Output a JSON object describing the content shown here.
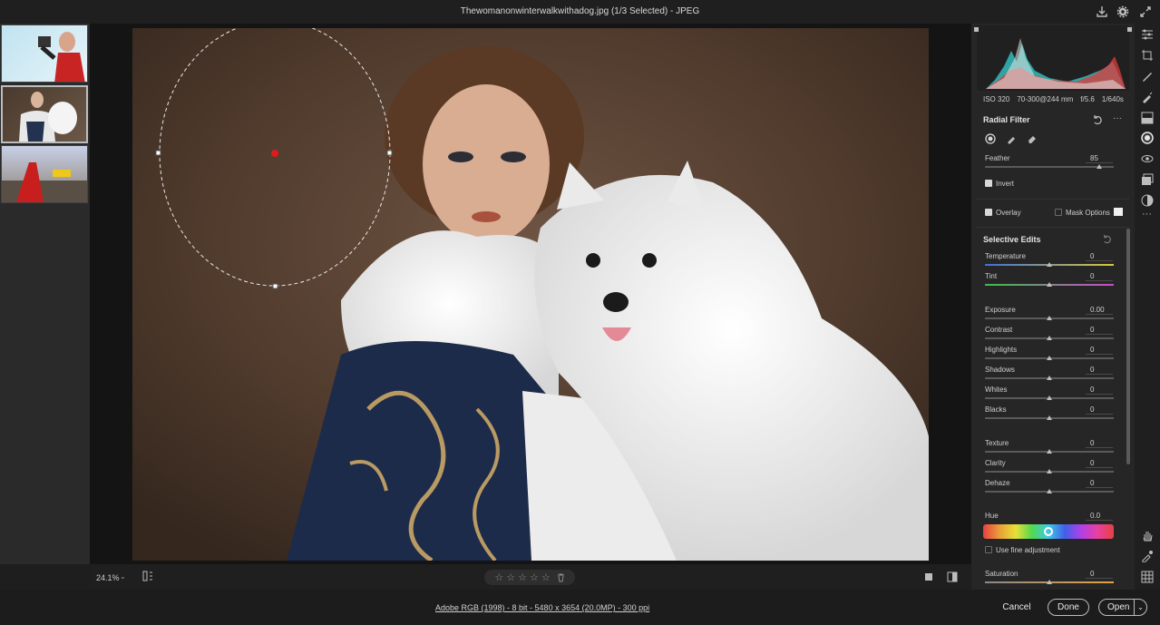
{
  "window": {
    "title": "Thewomanonwinterwalkwithadog.jpg (1/3 Selected)  -  JPEG"
  },
  "filmstrip": {
    "thumbnails": [
      {
        "name": "woman-camera-thumbnail"
      },
      {
        "name": "woman-dog-thumbnail",
        "selected": true
      },
      {
        "name": "woman-red-dress-thumbnail"
      }
    ]
  },
  "canvas": {
    "zoom": "24.1%",
    "zoom_dropdown_icon": "chevron-down-icon",
    "rating": [
      "☆",
      "☆",
      "☆",
      "☆",
      "☆"
    ],
    "delete_icon": "trash-icon"
  },
  "footer": {
    "file_info": "Adobe RGB (1998) - 8 bit - 5480 x 3654 (20.0MP) - 300 ppi",
    "cancel": "Cancel",
    "done": "Done",
    "open": "Open"
  },
  "panel": {
    "exif": [
      "ISO 320",
      "70-300@244 mm",
      "f/5.6",
      "1/640s"
    ],
    "radial_filter": {
      "title": "Radial Filter",
      "feather_label": "Feather",
      "feather_value": "85",
      "invert_label": "Invert",
      "overlay_label": "Overlay",
      "mask_options_label": "Mask Options"
    },
    "selective_edits": {
      "title": "Selective Edits",
      "sliders": [
        {
          "label": "Temperature",
          "value": "0"
        },
        {
          "label": "Tint",
          "value": "0"
        },
        {
          "label": "Exposure",
          "value": "0.00"
        },
        {
          "label": "Contrast",
          "value": "0"
        },
        {
          "label": "Highlights",
          "value": "0"
        },
        {
          "label": "Shadows",
          "value": "0"
        },
        {
          "label": "Whites",
          "value": "0"
        },
        {
          "label": "Blacks",
          "value": "0"
        },
        {
          "label": "Texture",
          "value": "0"
        },
        {
          "label": "Clarity",
          "value": "0"
        },
        {
          "label": "Dehaze",
          "value": "0"
        }
      ],
      "hue_label": "Hue",
      "hue_value": "0.0",
      "fine_adjust_label": "Use fine adjustment",
      "saturation_label": "Saturation",
      "saturation_value": "0"
    }
  },
  "colors": {
    "accent": "#d8d8d8",
    "pin": "#e01b1b"
  }
}
